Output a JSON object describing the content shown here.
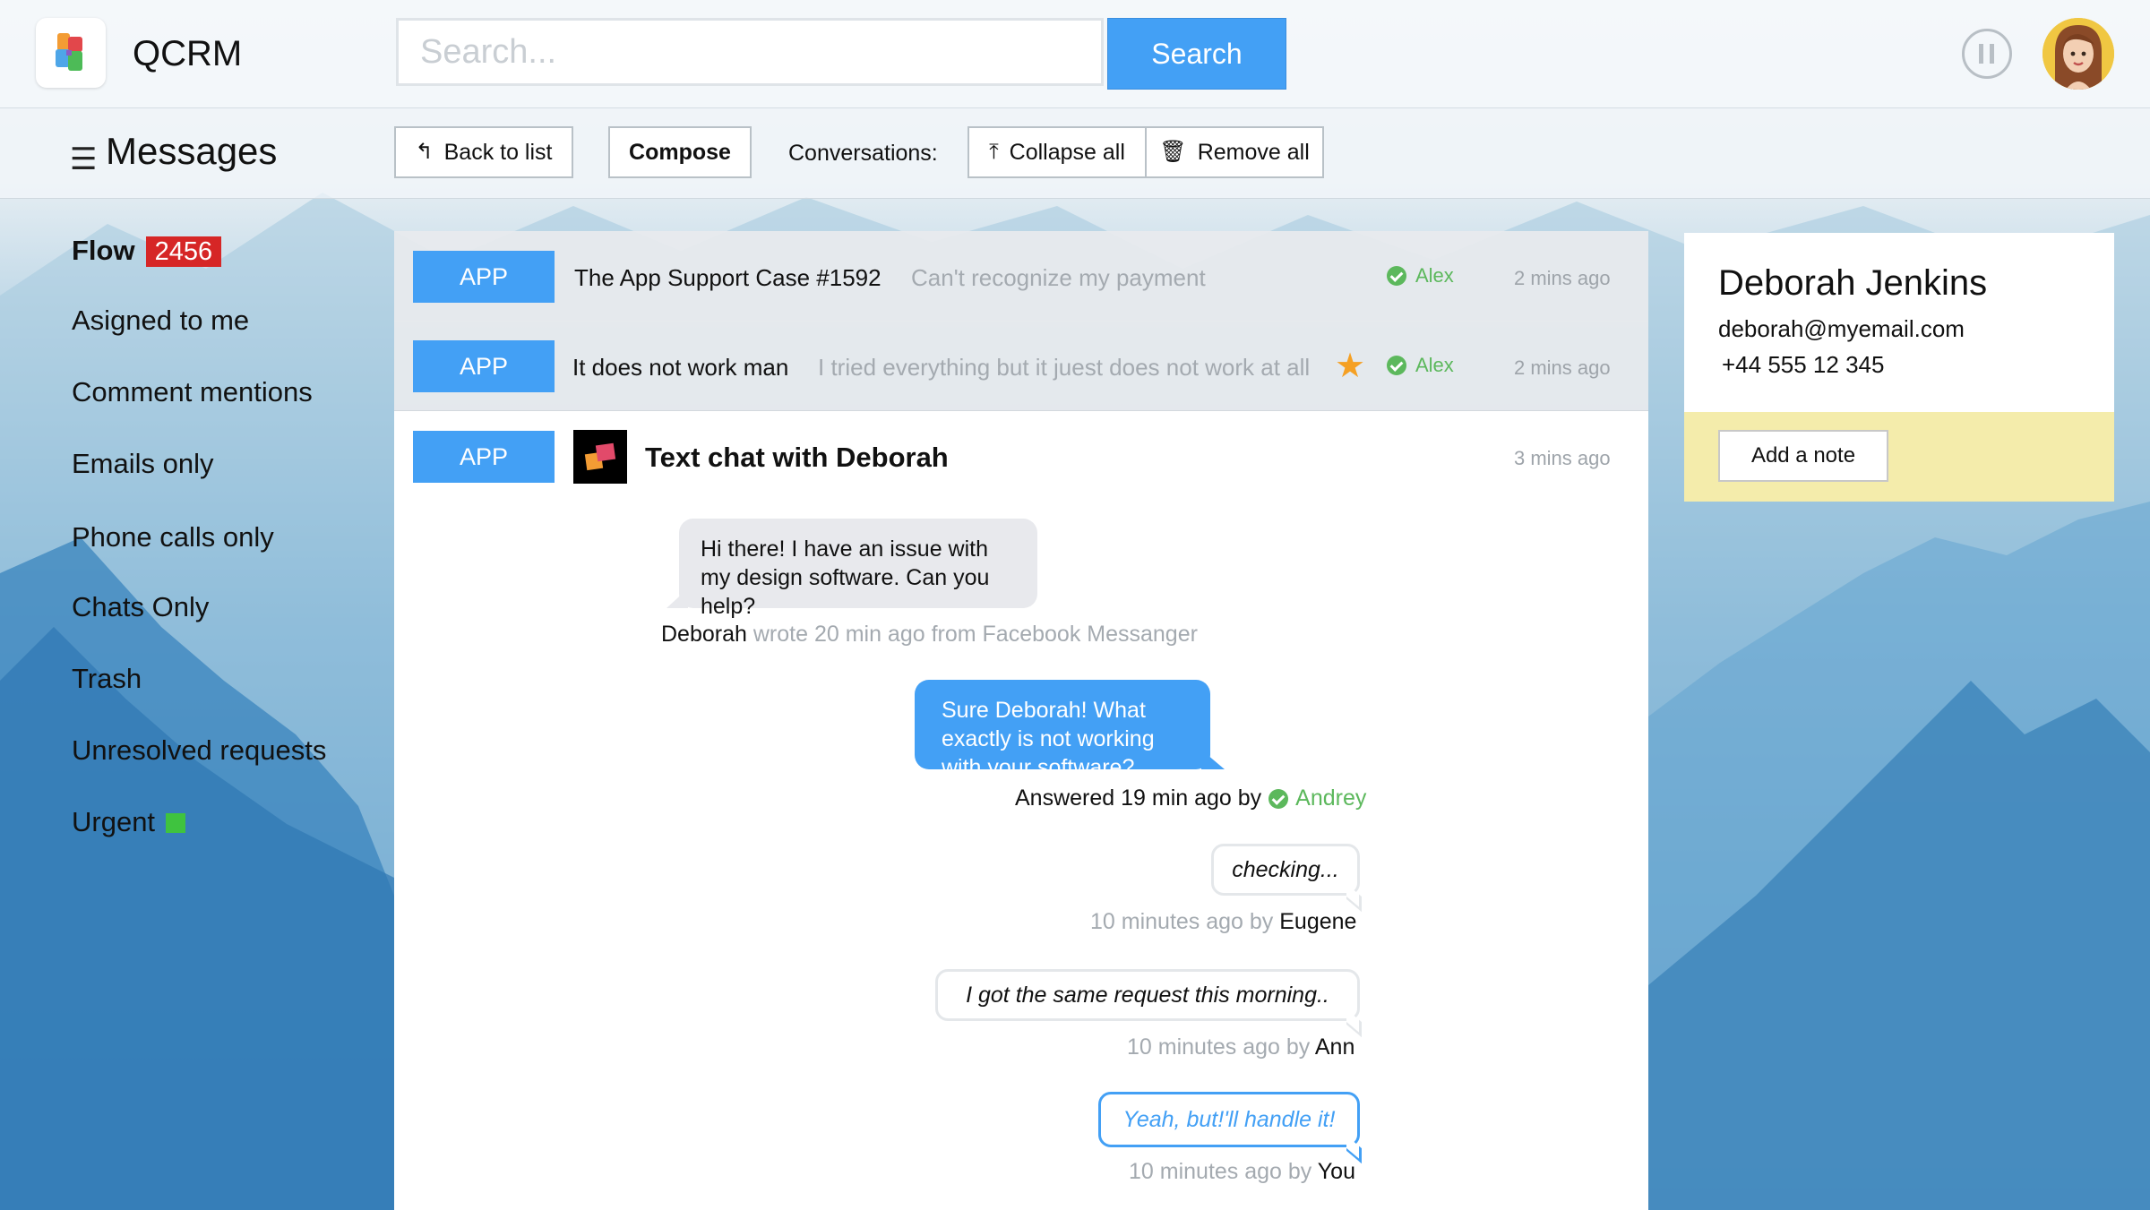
{
  "app": {
    "title": "QCRM"
  },
  "search": {
    "placeholder": "Search...",
    "button_label": "Search"
  },
  "toolbar": {
    "section_title": "Messages",
    "back_label": "Back to list",
    "compose_label": "Compose",
    "conversations_label": "Conversations:",
    "collapse_label": "Collapse all",
    "remove_label": "Remove all"
  },
  "sidebar": {
    "flow_label": "Flow",
    "flow_count": "2456",
    "items": [
      {
        "label": "Asigned to me"
      },
      {
        "label": "Comment mentions"
      },
      {
        "label": "Emails only"
      },
      {
        "label": "Phone calls only"
      },
      {
        "label": "Chats Only"
      },
      {
        "label": "Trash"
      },
      {
        "label": "Unresolved requests"
      },
      {
        "label": "Urgent"
      }
    ]
  },
  "list": {
    "rows": [
      {
        "badge": "APP",
        "subject": "The App Support Case #1592",
        "preview": "Can't recognize my payment",
        "agent": "Alex",
        "time": "2 mins ago",
        "starred": false
      },
      {
        "badge": "APP",
        "subject": "It does not work man",
        "preview": "I tried everything but it juest does not work at all",
        "agent": "Alex",
        "time": "2 mins ago",
        "starred": true
      }
    ]
  },
  "chat": {
    "badge": "APP",
    "title": "Text chat with Deborah",
    "time": "3 mins ago",
    "incoming": {
      "text": "Hi there! I have an issue with my design software. Can you help?",
      "author": "Deborah",
      "meta": "wrote 20 min ago from Facebook Messanger"
    },
    "outgoing": {
      "text": "Sure Deborah! What exactly is not working with your software?",
      "meta_prefix": "Answered 19 min ago by",
      "agent": "Andrey"
    },
    "notes": [
      {
        "text": "checking...",
        "meta": "10 minutes ago by",
        "author": "Eugene"
      },
      {
        "text": "I got the same request this morning..",
        "meta": "10 minutes ago by",
        "author": "Ann"
      },
      {
        "text": "Yeah, but!'ll handle it!",
        "meta": "10 minutes ago by",
        "author": "You"
      }
    ]
  },
  "contact": {
    "name": "Deborah Jenkins",
    "email": "deborah@myemail.com",
    "phone": "+44 555 12 345",
    "add_note_label": "Add a note"
  },
  "colors": {
    "accent": "#43a0f5",
    "badge_red": "#d62626",
    "agent_green": "#5cb85c",
    "star": "#f5a023",
    "note_bg": "#f4ecab"
  },
  "icons": [
    "menu-icon",
    "back-arrow-icon",
    "collapse-icon",
    "trash-icon",
    "check-icon",
    "star-icon",
    "pause-icon"
  ]
}
